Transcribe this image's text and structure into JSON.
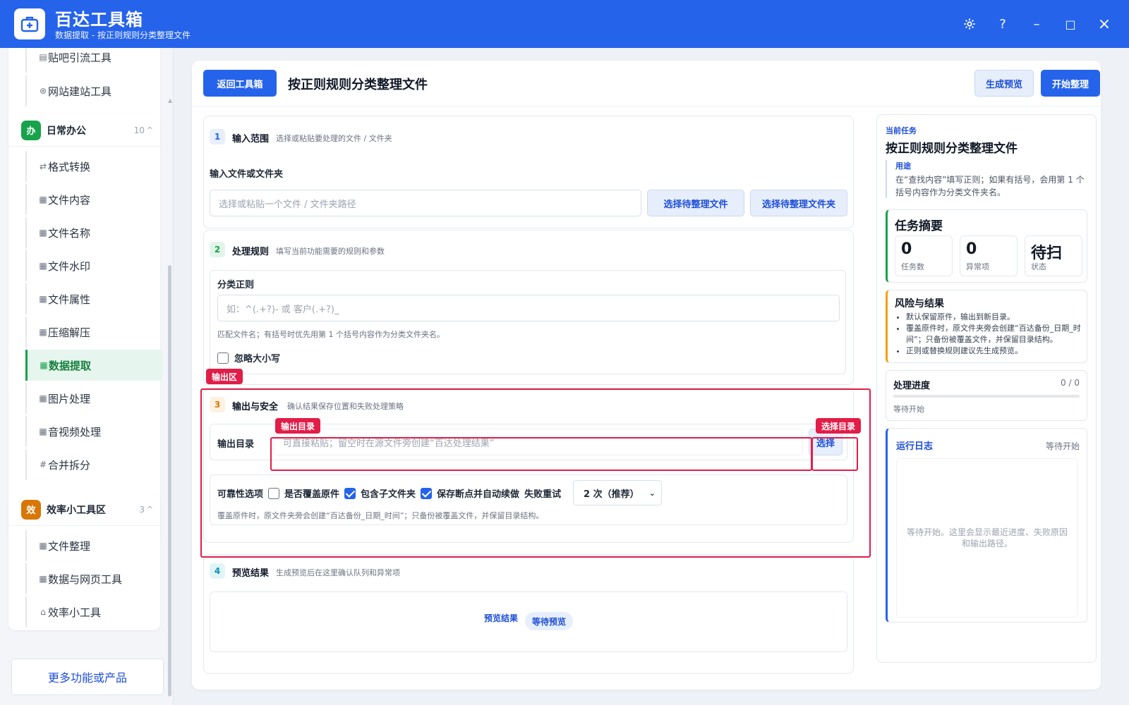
{
  "app": {
    "title": "百达工具箱",
    "subtitle": "数据提取 - 按正则规则分类整理文件",
    "controls": {
      "minimize": "–",
      "maximize": "□",
      "close": "×",
      "help": "?"
    }
  },
  "sidebar": {
    "top_items": [
      {
        "label": "贴吧引流工具",
        "icon": "list-icon"
      },
      {
        "label": "网站建站工具",
        "icon": "globe-icon"
      }
    ],
    "groups": [
      {
        "badge": "办",
        "name": "日常办公",
        "count": "10",
        "color": "#16a34a",
        "items": [
          {
            "label": "格式转换",
            "icon": "⇄"
          },
          {
            "label": "文件内容",
            "icon": "▦"
          },
          {
            "label": "文件名称",
            "icon": "▦"
          },
          {
            "label": "文件水印",
            "icon": "▦"
          },
          {
            "label": "文件属性",
            "icon": "▦"
          },
          {
            "label": "压缩解压",
            "icon": "▦"
          },
          {
            "label": "数据提取",
            "icon": "▦",
            "active": true
          },
          {
            "label": "图片处理",
            "icon": "▦"
          },
          {
            "label": "音视频处理",
            "icon": "▦"
          },
          {
            "label": "合并拆分",
            "icon": "#"
          }
        ]
      },
      {
        "badge": "效",
        "name": "效率小工具区",
        "count": "3",
        "color": "#d97706",
        "items": [
          {
            "label": "文件整理",
            "icon": "▦"
          },
          {
            "label": "数据与网页工具",
            "icon": "▦"
          },
          {
            "label": "效率小工具",
            "icon": "⌂"
          }
        ]
      }
    ],
    "more_button": "更多功能或产品"
  },
  "main": {
    "back_button": "返回工具箱",
    "title": "按正则规则分类整理文件",
    "preview_button": "生成预览",
    "start_button": "开始整理",
    "sections": {
      "input": {
        "step": "1",
        "title": "输入范围",
        "desc": "选择或粘贴要处理的文件 / 文件夹",
        "field_label": "输入文件或文件夹",
        "placeholder": "选择或粘贴一个文件 / 文件夹路径",
        "btn_file": "选择待整理文件",
        "btn_folder": "选择待整理文件夹"
      },
      "rules": {
        "step": "2",
        "title": "处理规则",
        "desc": "填写当前功能需要的规则和参数",
        "regex_label": "分类正则",
        "regex_placeholder": "如：^(.+?)- 或 客户(.+?)_",
        "hint": "匹配文件名；有括号时优先用第 1 个括号内容作为分类文件夹名。",
        "ignore_case": "忽略大小写"
      },
      "output": {
        "step": "3",
        "title": "输出与安全",
        "desc": "确认结果保存位置和失败处理策略",
        "dir_label": "输出目录",
        "dir_placeholder": "可直接粘贴；留空时在源文件旁创建“百达处理结果”",
        "choose_button": "选择",
        "reliability_label": "可靠性选项",
        "overwrite": "是否覆盖原件",
        "include_sub": "包含子文件夹",
        "resume": "保存断点并自动续做",
        "retry_label": "失败重试",
        "retry_value": "2 次（推荐）",
        "hint": "覆盖原件时，原文件夹旁会创建“百达备份_日期_时间”；只备份被覆盖文件，并保留目录结构。"
      },
      "preview": {
        "step": "4",
        "title": "预览结果",
        "desc": "生成预览后在这里确认队列和异常项",
        "result_label": "预览结果",
        "status": "等待预览"
      }
    },
    "annotations": {
      "output_area": "输出区",
      "output_dir": "输出目录",
      "choose_dir": "选择目录"
    }
  },
  "right_panel": {
    "current_label": "当前任务",
    "task_title": "按正则规则分类整理文件",
    "usage_label": "用途",
    "usage_text": "在“查找内容”填写正则；如果有括号，会用第 1 个括号内容作为分类文件夹名。",
    "summary": {
      "title": "任务摘要",
      "stats": [
        {
          "value": "0",
          "key": "任务数"
        },
        {
          "value": "0",
          "key": "异常项"
        },
        {
          "value": "待扫",
          "key": "状态"
        }
      ]
    },
    "risk": {
      "title": "风险与结果",
      "items": [
        "默认保留原件，输出到新目录。",
        "覆盖原件时，原文件夹旁会创建“百达备份_日期_时间”；只备份被覆盖文件，并保留目录结构。",
        "正则或替换规则建议先生成预览。"
      ]
    },
    "progress": {
      "title": "处理进度",
      "count": "0 / 0",
      "fraction": 0,
      "status": "等待开始"
    },
    "log": {
      "title": "运行日志",
      "status": "等待开始",
      "placeholder": "等待开始。这里会显示最近进度、失败原因和输出路径。"
    }
  },
  "colors": {
    "primary": "#2563eb",
    "accent_green": "#16a34a",
    "accent_orange": "#d97706",
    "annotation_red": "#e11d48"
  }
}
